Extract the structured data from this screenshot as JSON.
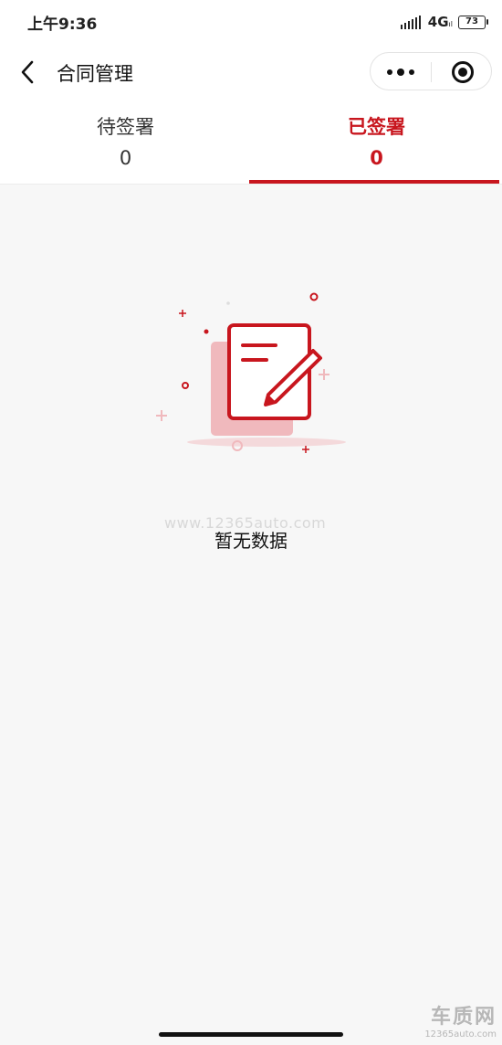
{
  "status_bar": {
    "time": "上午9:36",
    "network": "4G",
    "network_sub": "ıl",
    "battery": "73"
  },
  "nav": {
    "title": "合同管理",
    "back_icon": "chevron-left-icon",
    "more_icon": "more-dots-icon",
    "close_icon": "target-close-icon"
  },
  "tabs": [
    {
      "label": "待签署",
      "count": "0",
      "active": false
    },
    {
      "label": "已签署",
      "count": "0",
      "active": true
    }
  ],
  "empty_state": {
    "icon": "document-edit-icon",
    "text": "暂无数据"
  },
  "watermark": {
    "url": "www.12365auto.com",
    "logo": "车质网",
    "logo_url": "12365auto.com"
  },
  "colors": {
    "accent": "#c8161e",
    "background": "#f7f7f7"
  }
}
